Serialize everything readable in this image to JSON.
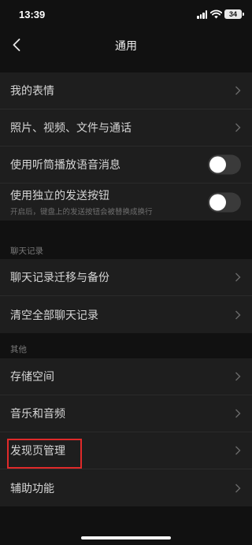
{
  "status_bar": {
    "time": "13:39",
    "battery": "34"
  },
  "nav": {
    "title": "通用",
    "back_icon": "chevron-left-icon"
  },
  "group1": {
    "items": [
      {
        "label": "我的表情"
      },
      {
        "label": "照片、视频、文件与通话"
      },
      {
        "label": "使用听筒播放语音消息",
        "toggle": false
      },
      {
        "label": "使用独立的发送按钮",
        "subtitle": "开启后，键盘上的发送按钮会被替换成换行",
        "toggle": false
      }
    ]
  },
  "chat_history": {
    "header": "聊天记录",
    "items": [
      {
        "label": "聊天记录迁移与备份"
      },
      {
        "label": "清空全部聊天记录"
      }
    ]
  },
  "other": {
    "header": "其他",
    "items": [
      {
        "label": "存储空间"
      },
      {
        "label": "音乐和音频"
      },
      {
        "label": "发现页管理"
      },
      {
        "label": "辅助功能"
      }
    ]
  },
  "colors": {
    "background": "#111111",
    "row_background": "#1e1e1e",
    "highlight": "#e02a2a"
  }
}
